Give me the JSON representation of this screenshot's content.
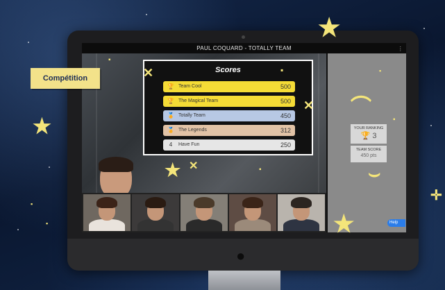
{
  "window": {
    "title": "PAUL COQUARD - TOTALLY TEAM"
  },
  "badge": {
    "label": "Compétition"
  },
  "scoreboard": {
    "title": "Scores",
    "rows": [
      {
        "rank_icon": "trophy-gold-icon",
        "icon_glyph": "🏆",
        "team": "Team Cool",
        "score": "500",
        "bg": "#f5dc36",
        "fg": "#333"
      },
      {
        "rank_icon": "trophy-gold-icon",
        "icon_glyph": "🏆",
        "team": "The Magical Team",
        "score": "500",
        "bg": "#f5dc36",
        "fg": "#333"
      },
      {
        "rank_icon": "medal-icon",
        "icon_glyph": "🏅",
        "team": "Totally Team",
        "score": "450",
        "bg": "#b7c8e4",
        "fg": "#333"
      },
      {
        "rank_icon": "medal-bronze-icon",
        "icon_glyph": "🏅",
        "team": "The Legends",
        "score": "312",
        "bg": "#e2c3a6",
        "fg": "#333"
      },
      {
        "rank_icon": "rank-number",
        "icon_glyph": "4",
        "team": "Have Fun",
        "score": "250",
        "bg": "#e6e6e6",
        "fg": "#333"
      }
    ]
  },
  "side_panel": {
    "ranking_label": "YOUR RANKING",
    "ranking_value": "3",
    "team_score_label": "TEAM SCORE",
    "team_score_value": "450 pts",
    "help_label": "Help"
  },
  "colors": {
    "accent_yellow": "#f4e57a",
    "badge_bg": "#f3e28a",
    "badge_text": "#1a2a55"
  }
}
